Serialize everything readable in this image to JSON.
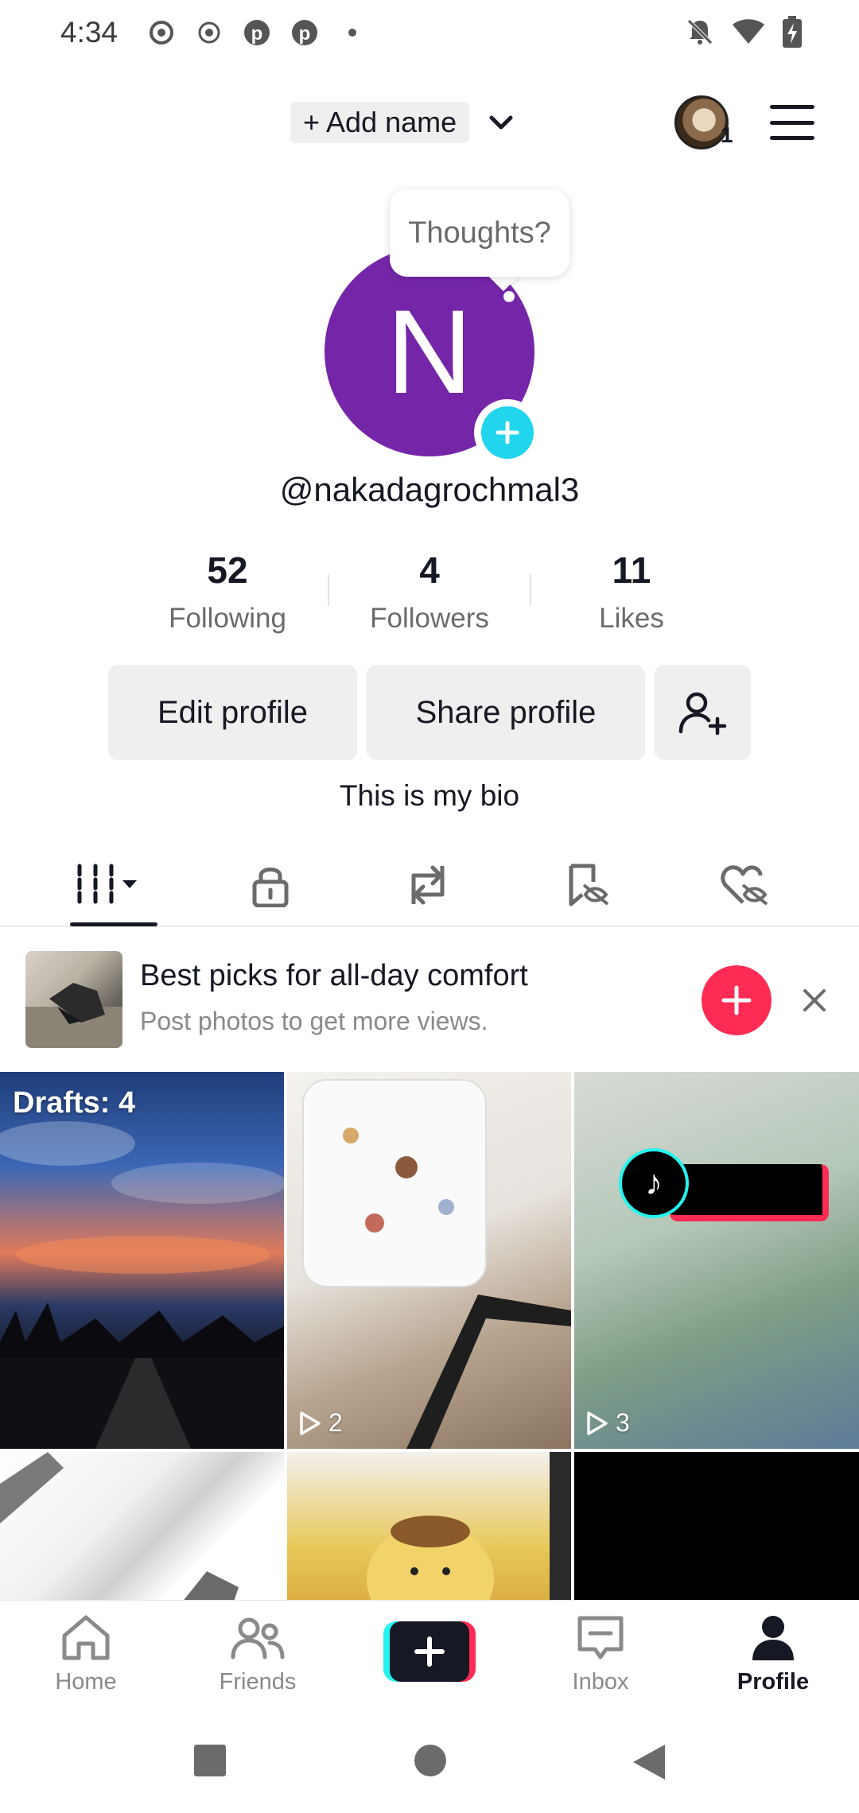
{
  "status_bar": {
    "time": "4:34",
    "left_icons": [
      "sync-icon",
      "record-icon",
      "pinterest-icon",
      "pinterest-icon",
      "dot-icon"
    ],
    "right_icons": [
      "bell-off-icon",
      "wifi-icon",
      "battery-charging-icon"
    ]
  },
  "header": {
    "add_name_label": "+ Add name",
    "account_badge_count": "1"
  },
  "profile": {
    "avatar_initial": "N",
    "thought_bubble": "Thoughts?",
    "username": "@nakadagrochmal3",
    "bio": "This is my bio",
    "avatar_color": "#7526a8"
  },
  "stats": [
    {
      "value": "52",
      "label": "Following"
    },
    {
      "value": "4",
      "label": "Followers"
    },
    {
      "value": "11",
      "label": "Likes"
    }
  ],
  "actions": {
    "edit_profile": "Edit profile",
    "share_profile": "Share profile"
  },
  "tabs": [
    "videos-grid-icon",
    "lock-icon",
    "repost-icon",
    "favorites-icon",
    "liked-icon"
  ],
  "promo": {
    "title": "Best picks for all-day comfort",
    "subtitle": "Post photos to get more views."
  },
  "grid": {
    "drafts_label": "Drafts: 4",
    "items": [
      {
        "play_count": ""
      },
      {
        "play_count": "2"
      },
      {
        "play_count": "3"
      }
    ]
  },
  "bottom_nav": [
    {
      "label": "Home",
      "icon": "home-icon"
    },
    {
      "label": "Friends",
      "icon": "friends-icon"
    },
    {
      "label": "",
      "icon": "create-icon"
    },
    {
      "label": "Inbox",
      "icon": "inbox-icon"
    },
    {
      "label": "Profile",
      "icon": "profile-icon"
    }
  ],
  "colors": {
    "accent_red": "#fe2c55",
    "accent_cyan": "#25f4ee",
    "plus_badge": "#20d5ec"
  }
}
